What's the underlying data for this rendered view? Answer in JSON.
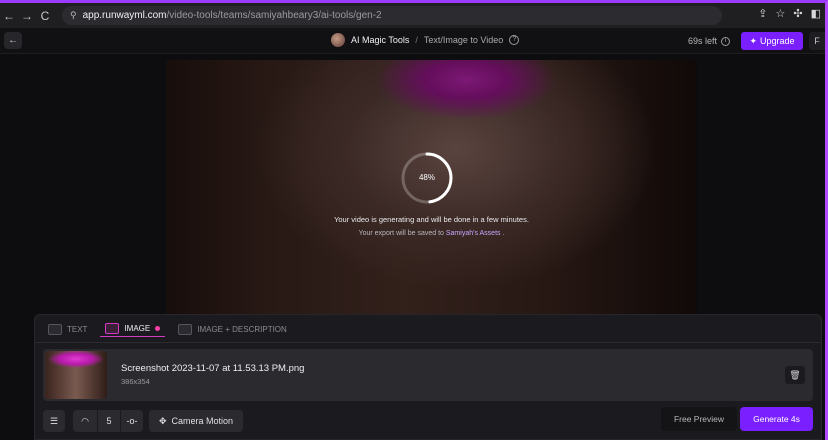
{
  "browser": {
    "url_host": "app.runwayml.com",
    "url_path": "/video-tools/teams/samiyahbeary3/ai-tools/gen-2",
    "back_icon": "arrow-left-icon",
    "forward_icon": "arrow-right-icon",
    "reload_icon": "reload-icon"
  },
  "header": {
    "breadcrumb_main": "AI Magic Tools",
    "breadcrumb_sep": "/",
    "breadcrumb_sub": "Text/Image to Video",
    "help_glyph": "?",
    "credits": "69s left",
    "upgrade_label": "Upgrade",
    "extra_label": "F"
  },
  "video": {
    "progress_percent": 48,
    "progress_label": "48%",
    "generating_message": "Your video is generating and will be done in a few minutes.",
    "export_prefix": "Your export will be saved to ",
    "export_link": "Samiyah's Assets",
    "export_suffix": " ."
  },
  "panel": {
    "tabs": [
      {
        "label": "TEXT",
        "active": false
      },
      {
        "label": "IMAGE",
        "active": true
      },
      {
        "label": "IMAGE + DESCRIPTION",
        "active": false
      }
    ],
    "file": {
      "name": "Screenshot 2023-11-07 at 11.53.13 PM.png",
      "dims": "386x354"
    },
    "toolbar": {
      "motion_value": "5",
      "camera_motion_label": "Camera Motion",
      "free_preview_label": "Free Preview",
      "generate_label": "Generate 4s"
    }
  },
  "colors": {
    "accent": "#7a1fff",
    "tab_active": "#d53ac3",
    "link": "#c8a8ff"
  }
}
